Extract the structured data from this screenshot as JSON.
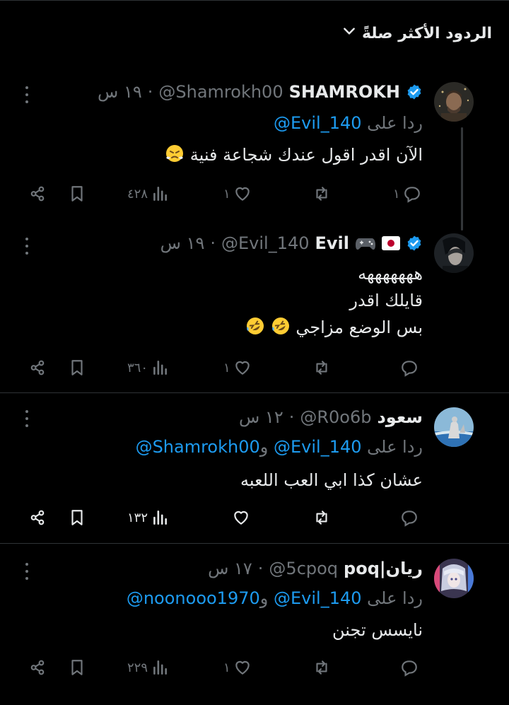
{
  "sort": {
    "label": "الردود الأكثر صلةً"
  },
  "posts": [
    {
      "name": "SHAMROKH",
      "handle": "@Shamrokh00",
      "time": "١٩ س",
      "reply_prefix": "ردا على",
      "mentions": [
        "@Evil_140"
      ],
      "lines": [
        "الآن اقدر اقول عندك شجاعة فنية"
      ],
      "emoji": "steam-from-nose-emoji",
      "views": "٤٢٨",
      "likes": "١",
      "replies": "١",
      "verified": true
    },
    {
      "name": "Evil",
      "handle": "@Evil_140",
      "time": "١٩ س",
      "lines": [
        "هههههههه",
        "قايلك اقدر",
        "بس الوضع مزاجي"
      ],
      "emoji": "rolling-on-floor-laughing-emoji",
      "views": "٣٦٠",
      "likes": "١",
      "verified": true
    },
    {
      "name": "سعود",
      "handle": "@R0o6b",
      "time": "١٢ س",
      "reply_prefix": "ردا على",
      "mentions": [
        "@Evil_140",
        "@Shamrokh00"
      ],
      "and": "و",
      "lines": [
        "عشان كذا ابي العب اللعبه"
      ],
      "views": "١٣٢"
    },
    {
      "name": "ريان|poq",
      "handle": "@5cpoq",
      "time": "١٧ س",
      "reply_prefix": "ردا على",
      "mentions": [
        "@Evil_140",
        "@noonooo1970"
      ],
      "and": "و",
      "lines": [
        "نايسس تجنن"
      ],
      "views": "٢٢٩",
      "likes": "١"
    }
  ],
  "colors": {
    "background": "#000000",
    "text": "#e7e9ea",
    "muted": "#71767b",
    "accent": "#1d9bf0",
    "divider": "#2f3336"
  },
  "icons": [
    "chevron-down-icon",
    "verified-badge-icon",
    "more-icon",
    "reply-icon",
    "retweet-icon",
    "like-icon",
    "views-icon",
    "bookmark-icon",
    "share-icon"
  ]
}
